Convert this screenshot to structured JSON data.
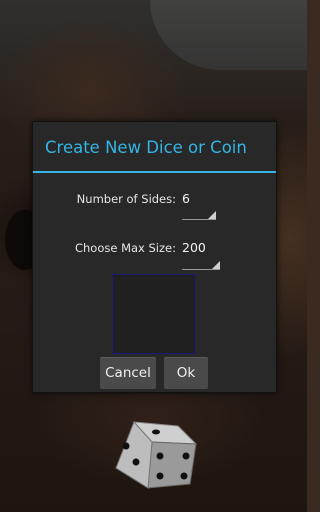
{
  "dialog": {
    "title": "Create New Dice or Coin",
    "sides_label": "Number of Sides:",
    "sides_value": "6",
    "max_size_label": "Choose Max Size:",
    "max_size_value": "200",
    "cancel_label": "Cancel",
    "ok_label": "Ok"
  },
  "colors": {
    "accent": "#33b5e5",
    "dialog_bg": "#282828",
    "button_bg": "#4a4a4a"
  },
  "icons": {
    "dice": "dice-icon",
    "spinner": "spinner-arrow-icon"
  }
}
